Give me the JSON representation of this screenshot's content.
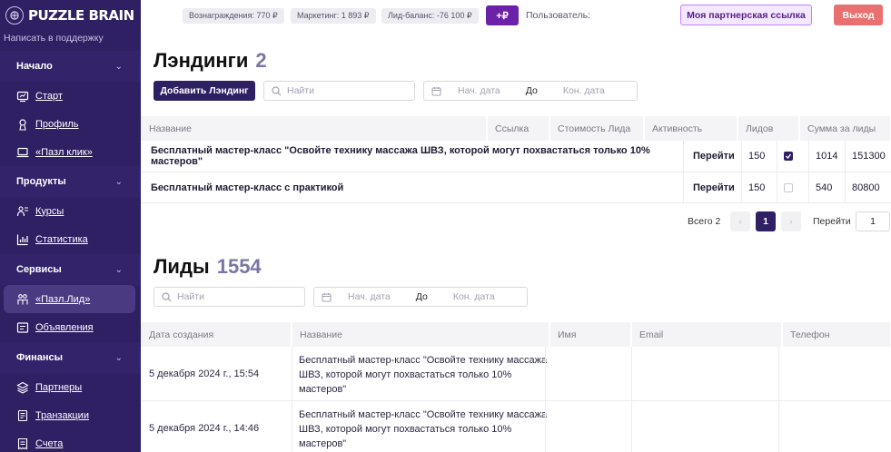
{
  "brand": {
    "name": "PUZZLE BRAIN",
    "support": "Написать в поддержку"
  },
  "sidebar": {
    "groups": [
      {
        "title": "Начало",
        "items": [
          {
            "label": "Старт"
          },
          {
            "label": "Профиль"
          },
          {
            "label": "«Пазл клик»"
          }
        ]
      },
      {
        "title": "Продукты",
        "items": [
          {
            "label": "Курсы"
          },
          {
            "label": "Статистика"
          }
        ]
      },
      {
        "title": "Сервисы",
        "items": [
          {
            "label": "«Пазл.Лид»"
          },
          {
            "label": "Объявления"
          }
        ]
      },
      {
        "title": "Финансы",
        "items": [
          {
            "label": "Партнеры"
          },
          {
            "label": "Транзакции"
          },
          {
            "label": "Счета"
          }
        ]
      }
    ]
  },
  "topbar": {
    "rewards": "Вознаграждения: 770 ₽",
    "marketing": "Маркетинг: 1 893 ₽",
    "lead_balance": "Лид-баланс: -76 100 ₽",
    "plus": "+₽",
    "user": "Пользователь:",
    "partner_link": "Моя партнерская ссылка",
    "logout": "Выход"
  },
  "landings": {
    "title": "Лэндинги",
    "count": "2",
    "add_button": "Добавить Лэндинг",
    "search_placeholder": "Найти",
    "date_from": "Нач. дата",
    "date_to_label": "До",
    "date_to": "Кон. дата",
    "columns": [
      "Название",
      "Ссылка",
      "Стоимость Лида",
      "Активность",
      "Лидов",
      "Сумма за лиды"
    ],
    "rows": [
      {
        "name": "Бесплатный мастер-класс \"Освойте технику массажа ШВЗ, которой могут похвастаться только 10% мастеров\"",
        "link": "Перейти",
        "price": "150",
        "active": true,
        "leads": "1014",
        "sum": "151300"
      },
      {
        "name": "Бесплатный мастер-класс с практикой",
        "link": "Перейти",
        "price": "150",
        "active": false,
        "leads": "540",
        "sum": "80800"
      }
    ],
    "pagination": {
      "total": "Всего 2",
      "page": "1",
      "goto": "Перейти",
      "goto_value": "1"
    }
  },
  "leads": {
    "title": "Лиды",
    "count": "1554",
    "search_placeholder": "Найти",
    "date_from": "Нач. дата",
    "date_to_label": "До",
    "date_to": "Кон. дата",
    "columns": [
      "Дата создания",
      "Название",
      "Имя",
      "Email",
      "Телефон"
    ],
    "rows": [
      {
        "date": "5 декабря 2024 г., 15:54",
        "name_lines": [
          "Бесплатный мастер-класс \"Освойте технику массажа",
          "ШВЗ, которой могут похвастаться только 10%",
          "мастеров\""
        ]
      },
      {
        "date": "5 декабря 2024 г., 14:46",
        "name_lines": [
          "Бесплатный мастер-класс \"Освойте технику массажа",
          "ШВЗ, которой могут похвастаться только 10%",
          "мастеров\""
        ]
      }
    ]
  }
}
